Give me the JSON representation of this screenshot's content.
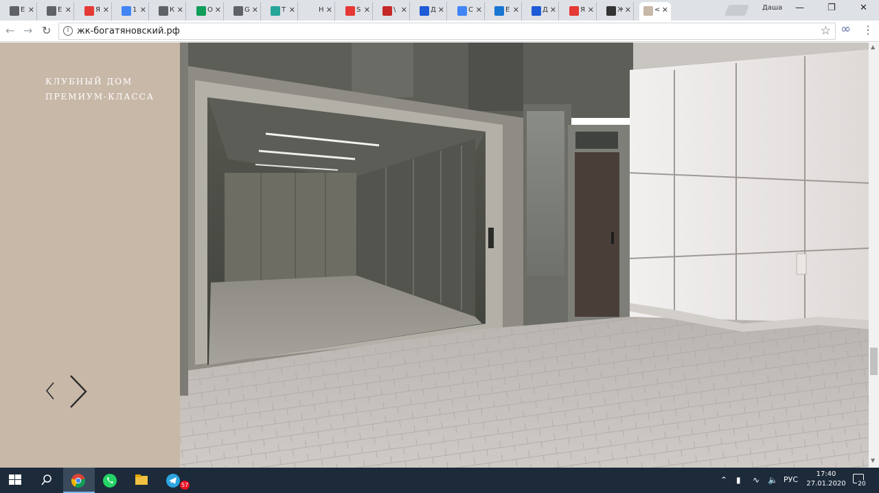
{
  "browser": {
    "tabs": [
      {
        "label": "E",
        "favicon": "folder-icon",
        "color": "#5f6368"
      },
      {
        "label": "E",
        "favicon": "folder-icon",
        "color": "#5f6368"
      },
      {
        "label": "Я",
        "favicon": "map-pin-icon",
        "color": "#e53935"
      },
      {
        "label": "1",
        "favicon": "docs-icon",
        "color": "#4285f4"
      },
      {
        "label": "К",
        "favicon": "folder-icon",
        "color": "#5f6368"
      },
      {
        "label": "О",
        "favicon": "green-plus-icon",
        "color": "#0f9d58"
      },
      {
        "label": "G",
        "favicon": "folder-icon",
        "color": "#5f6368"
      },
      {
        "label": "Т",
        "favicon": "teal-triangle-icon",
        "color": "#26a69a"
      },
      {
        "label": "Н",
        "favicon": "blank-icon",
        "color": "#dee1e6"
      },
      {
        "label": "S",
        "favicon": "s-logo-icon",
        "color": "#e53935"
      },
      {
        "label": "\\",
        "favicon": "flag-icon",
        "color": "#c62828"
      },
      {
        "label": "Д",
        "favicon": "target-icon",
        "color": "#1e5bd6"
      },
      {
        "label": "С",
        "favicon": "chat-icon",
        "color": "#4285f4"
      },
      {
        "label": "Е",
        "favicon": "circle-e-icon",
        "color": "#1976d2"
      },
      {
        "label": "Д",
        "favicon": "target-icon",
        "color": "#1e5bd6"
      },
      {
        "label": "Я",
        "favicon": "map-pin-icon",
        "color": "#e53935"
      },
      {
        "label": "Ж",
        "favicon": "wikipedia-icon",
        "color": "#333333"
      },
      {
        "label": "<",
        "favicon": "beige-dot-icon",
        "color": "#c8b8a8"
      }
    ],
    "profile_name": "Даша",
    "url": "жк-богатяновский.рф"
  },
  "page": {
    "tagline": "КЛУБНЫЙ ДОМ ПРЕМИУМ-КЛАССА",
    "colors": {
      "sidebar": "#c8b8a8"
    }
  },
  "taskbar": {
    "language": "РУС",
    "time": "17:40",
    "date": "27.01.2020",
    "telegram_badge": "57",
    "notification_count": "20"
  }
}
